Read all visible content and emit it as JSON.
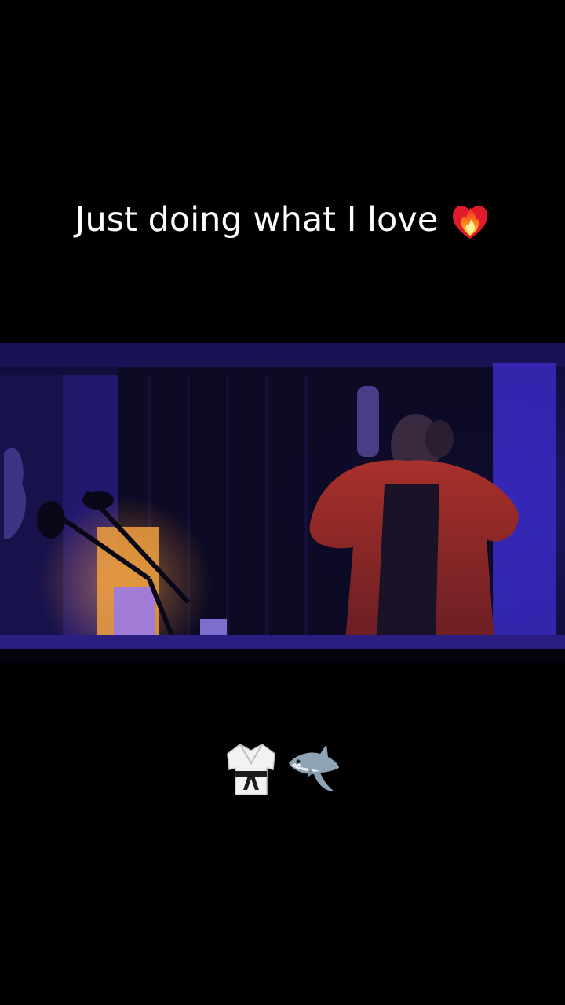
{
  "caption": {
    "text": "Just doing what I love",
    "emoji": "heart-on-fire-icon"
  },
  "video": {
    "scene": "recording-studio-booth",
    "lighting_colors": [
      "#3a2bd0",
      "#6a2bb8",
      "#f0a040"
    ]
  },
  "bottom_emojis": [
    {
      "icon": "martial-arts-uniform-icon"
    },
    {
      "icon": "shark-icon"
    }
  ],
  "colors": {
    "background": "#000000",
    "text": "#ffffff"
  }
}
